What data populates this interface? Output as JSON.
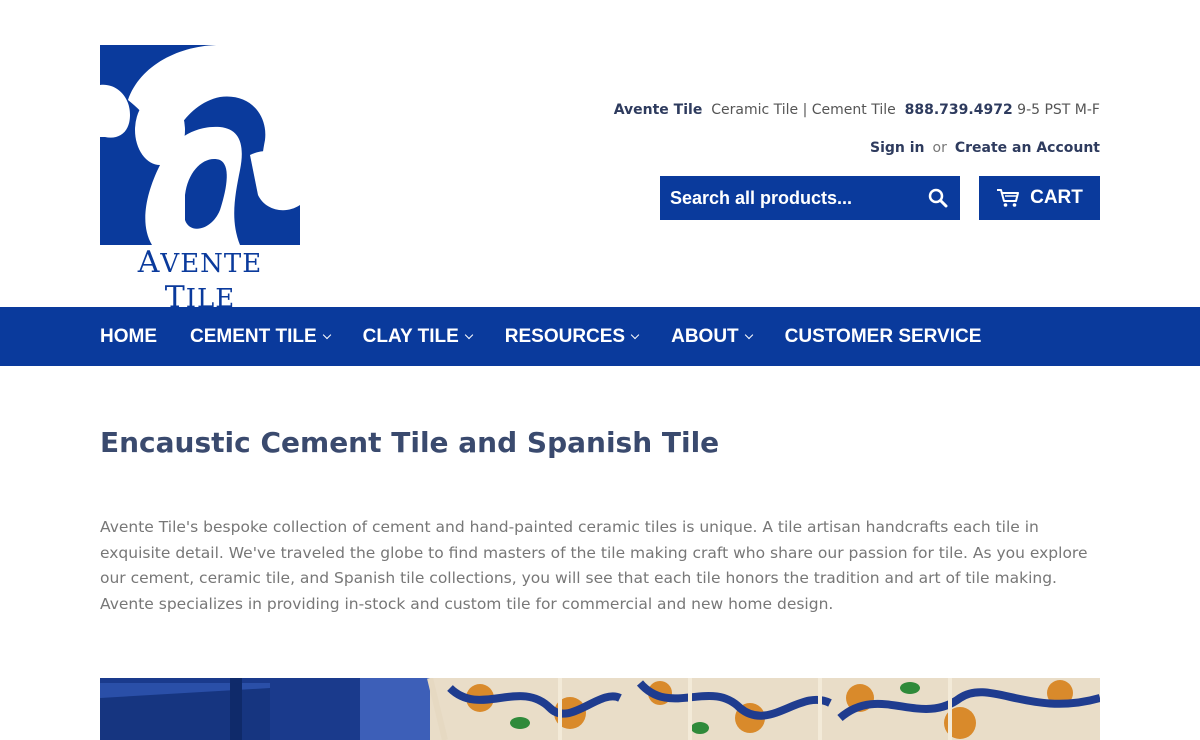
{
  "logo": {
    "text_first": "A",
    "text_rest": "VENTE ",
    "text_first2": "T",
    "text_rest2": "ILE"
  },
  "header": {
    "brand": "Avente Tile",
    "tagline": "Ceramic Tile | Cement Tile",
    "phone": "888.739.4972",
    "hours": "9-5 PST M-F",
    "sign_in": "Sign in",
    "or": "or",
    "create_account": "Create an Account",
    "search_placeholder": "Search all products...",
    "cart_label": "CART"
  },
  "nav": {
    "items": [
      {
        "label": "HOME"
      },
      {
        "label": "CEMENT TILE"
      },
      {
        "label": "CLAY TILE"
      },
      {
        "label": "RESOURCES"
      },
      {
        "label": "ABOUT"
      },
      {
        "label": "CUSTOMER SERVICE"
      }
    ]
  },
  "main": {
    "title": "Encaustic Cement Tile and Spanish Tile",
    "intro": "Avente Tile's bespoke collection of cement and hand-painted ceramic tiles is unique. A tile artisan handcrafts each tile in exquisite detail. We've traveled the globe to find masters of the tile making craft who share our passion for tile. As you explore our cement, ceramic tile, and Spanish tile collections, you will see that each tile honors the tradition and art of tile making. Avente specializes in providing in-stock and custom tile for commercial and new home design."
  },
  "colors": {
    "brand_blue": "#0a3a9c",
    "heading": "#3a4a6e",
    "body_text": "#777777"
  }
}
